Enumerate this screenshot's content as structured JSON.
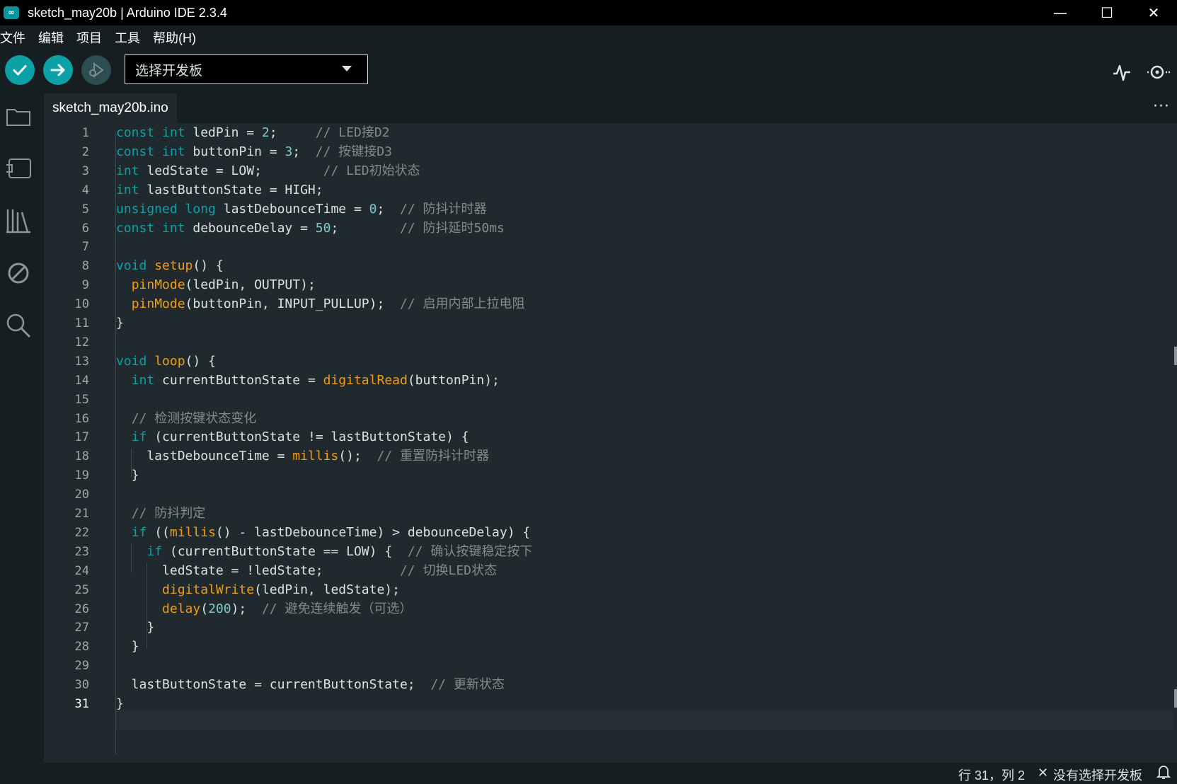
{
  "window": {
    "logo_text": "∞",
    "title": "sketch_may20b | Arduino IDE 2.3.4",
    "minimize": "—",
    "maximize": "☐",
    "close": "✕"
  },
  "menu": [
    "文件",
    "编辑",
    "项目",
    "工具",
    "帮助(H)"
  ],
  "toolbar": {
    "board_select_label": "选择开发板",
    "icons": [
      "verify-icon",
      "upload-icon",
      "debug-icon",
      "serial-plotter-icon",
      "serial-monitor-icon"
    ]
  },
  "sidebar": {
    "icons": [
      "sketchbook-folder-icon",
      "boards-manager-icon",
      "library-manager-icon",
      "debug-icon",
      "search-icon"
    ]
  },
  "tabs": [
    {
      "label": "sketch_may20b.ino"
    }
  ],
  "tab_more": "···",
  "editor": {
    "lines": [
      {
        "n": "1",
        "code": "const int ledPin = 2;     // LED接D2"
      },
      {
        "n": "2",
        "code": "const int buttonPin = 3;  // 按键接D3"
      },
      {
        "n": "3",
        "code": "int ledState = LOW;        // LED初始状态"
      },
      {
        "n": "4",
        "code": "int lastButtonState = HIGH;"
      },
      {
        "n": "5",
        "code": "unsigned long lastDebounceTime = 0;  // 防抖计时器"
      },
      {
        "n": "6",
        "code": "const int debounceDelay = 50;        // 防抖延时50ms"
      },
      {
        "n": "7",
        "code": ""
      },
      {
        "n": "8",
        "code": "void setup() {"
      },
      {
        "n": "9",
        "code": "  pinMode(ledPin, OUTPUT);"
      },
      {
        "n": "10",
        "code": "  pinMode(buttonPin, INPUT_PULLUP);  // 启用内部上拉电阻"
      },
      {
        "n": "11",
        "code": "}"
      },
      {
        "n": "12",
        "code": ""
      },
      {
        "n": "13",
        "code": "void loop() {"
      },
      {
        "n": "14",
        "code": "  int currentButtonState = digitalRead(buttonPin);"
      },
      {
        "n": "15",
        "code": ""
      },
      {
        "n": "16",
        "code": "  // 检测按键状态变化"
      },
      {
        "n": "17",
        "code": "  if (currentButtonState != lastButtonState) {"
      },
      {
        "n": "18",
        "code": "    lastDebounceTime = millis();  // 重置防抖计时器"
      },
      {
        "n": "19",
        "code": "  }"
      },
      {
        "n": "20",
        "code": ""
      },
      {
        "n": "21",
        "code": "  // 防抖判定"
      },
      {
        "n": "22",
        "code": "  if ((millis() - lastDebounceTime) > debounceDelay) {"
      },
      {
        "n": "23",
        "code": "    if (currentButtonState == LOW) {  // 确认按键稳定按下"
      },
      {
        "n": "24",
        "code": "      ledState = !ledState;          // 切换LED状态"
      },
      {
        "n": "25",
        "code": "      digitalWrite(ledPin, ledState);"
      },
      {
        "n": "26",
        "code": "      delay(200);  // 避免连续触发（可选）"
      },
      {
        "n": "27",
        "code": "    }"
      },
      {
        "n": "28",
        "code": "  }"
      },
      {
        "n": "29",
        "code": ""
      },
      {
        "n": "30",
        "code": "  lastButtonState = currentButtonState;  // 更新状态"
      },
      {
        "n": "31",
        "code": "}"
      }
    ],
    "current_line": 31,
    "colors": {
      "keyword": "#0ca1a6",
      "function": "#f39c12",
      "number": "#7fcbcd",
      "comment": "#7f8c8d",
      "text": "#dae3e3"
    }
  },
  "status": {
    "position": "行 31，列 2",
    "board_status_icon": "✕",
    "board_status": "没有选择开发板",
    "notification_icon": "bell-icon"
  }
}
